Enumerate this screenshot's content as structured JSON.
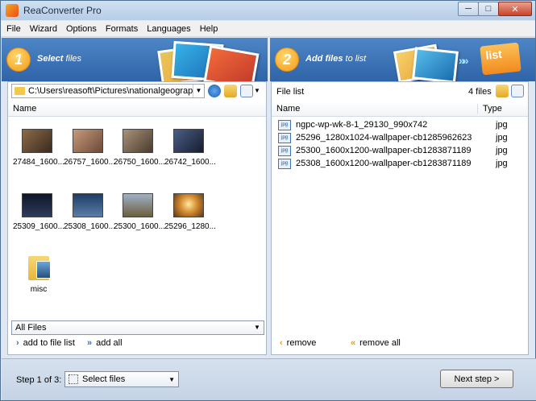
{
  "window": {
    "title": "ReaConverter Pro",
    "controls": [
      "─",
      "□",
      "✕"
    ]
  },
  "menu": [
    "File",
    "Wizard",
    "Options",
    "Formats",
    "Languages",
    "Help"
  ],
  "step1": {
    "number": "1",
    "title_main": "Select",
    "title_rest": " files"
  },
  "step2": {
    "number": "2",
    "title_main": "Add files",
    "title_rest": " to list",
    "badge": "list"
  },
  "left": {
    "path": "C:\\Users\\reasoft\\Pictures\\nationalgeographic",
    "column": "Name",
    "thumbs": [
      {
        "label": "27484_1600...",
        "color": "#5a4a3a"
      },
      {
        "label": "26757_1600...",
        "color": "#8a6a55"
      },
      {
        "label": "26750_1600...",
        "color": "#6d5e48"
      },
      {
        "label": "26742_1600...",
        "color": "#2a3448"
      },
      {
        "label": "25309_1600...",
        "color": "#1c2538"
      },
      {
        "label": "25308_1600...",
        "color": "#27405e"
      },
      {
        "label": "25300_1600...",
        "color": "#7b8aa0"
      },
      {
        "label": "25296_1280...",
        "color": "#c48a3a"
      }
    ],
    "folder": {
      "label": "misc"
    },
    "filter": "All Files",
    "add_to_list": "add to file list",
    "add_all": "add all"
  },
  "right": {
    "header": "File list",
    "count": "4 files",
    "columns": {
      "name": "Name",
      "type": "Type"
    },
    "files": [
      {
        "name": "ngpc-wp-wk-8-1_29130_990x742",
        "type": "jpg"
      },
      {
        "name": "25296_1280x1024-wallpaper-cb1285962623",
        "type": "jpg"
      },
      {
        "name": "25300_1600x1200-wallpaper-cb1283871189",
        "type": "jpg"
      },
      {
        "name": "25308_1600x1200-wallpaper-cb1283871189",
        "type": "jpg"
      }
    ],
    "file_icon": "jpg",
    "remove": "remove",
    "remove_all": "remove all"
  },
  "footer": {
    "step_label": "Step 1 of 3:",
    "step_select": "Select files",
    "next": "Next step >"
  }
}
